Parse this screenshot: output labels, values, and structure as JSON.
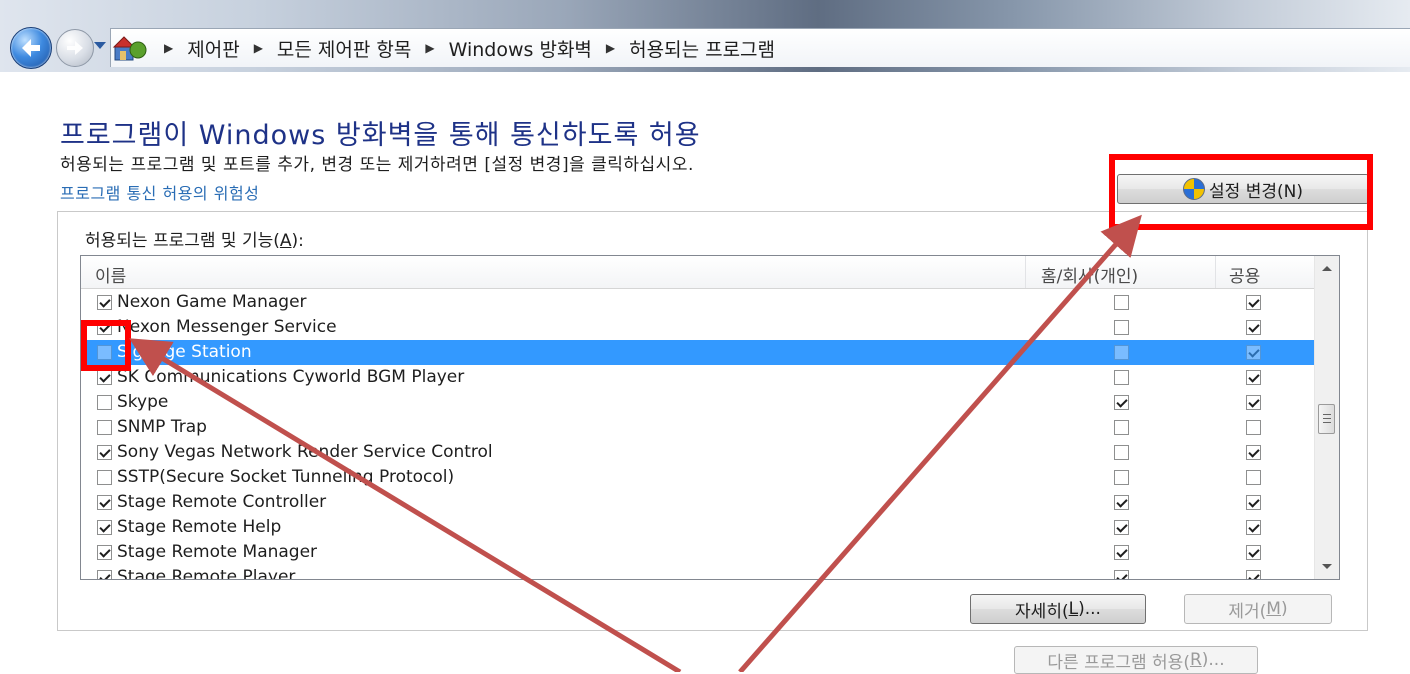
{
  "breadcrumb": {
    "items": [
      "제어판",
      "모든 제어판 항목",
      "Windows 방화벽",
      "허용되는 프로그램"
    ]
  },
  "header": {
    "title": "프로그램이 Windows 방화벽을 통해 통신하도록 허용",
    "description": "허용되는 프로그램 및 포트를 추가, 변경 또는 제거하려면 [설정 변경]을 클릭하십시오.",
    "risk_link": "프로그램 통신 허용의 위험성",
    "change_settings_label": "설정 변경(N)"
  },
  "group": {
    "label_prefix": "허용되는 프로그램 및 기능(",
    "label_accel": "A",
    "label_suffix": "):"
  },
  "list": {
    "columns": {
      "name": "이름",
      "home": "홈/회사(개인)",
      "public": "공용"
    },
    "rows": [
      {
        "name": "Nexon Game Manager",
        "enabled": true,
        "home": false,
        "public": true,
        "selected": false
      },
      {
        "name": "Nexon Messenger Service",
        "enabled": true,
        "home": false,
        "public": true,
        "selected": false
      },
      {
        "name": "Signage Station",
        "enabled": false,
        "home": false,
        "public": true,
        "selected": true
      },
      {
        "name": "SK Communications Cyworld BGM Player",
        "enabled": true,
        "home": false,
        "public": true,
        "selected": false
      },
      {
        "name": "Skype",
        "enabled": false,
        "home": true,
        "public": true,
        "selected": false
      },
      {
        "name": "SNMP Trap",
        "enabled": false,
        "home": false,
        "public": false,
        "selected": false
      },
      {
        "name": "Sony Vegas Network Render Service Control",
        "enabled": true,
        "home": false,
        "public": true,
        "selected": false
      },
      {
        "name": "SSTP(Secure Socket Tunneling Protocol)",
        "enabled": false,
        "home": false,
        "public": false,
        "selected": false
      },
      {
        "name": "Stage Remote Controller",
        "enabled": true,
        "home": true,
        "public": true,
        "selected": false
      },
      {
        "name": "Stage Remote Help",
        "enabled": true,
        "home": true,
        "public": true,
        "selected": false
      },
      {
        "name": "Stage Remote Manager",
        "enabled": true,
        "home": true,
        "public": true,
        "selected": false
      },
      {
        "name": "Stage Remote Player",
        "enabled": true,
        "home": true,
        "public": true,
        "selected": false
      }
    ]
  },
  "buttons": {
    "details_prefix": "자세히(",
    "details_accel": "L",
    "details_suffix": ")...",
    "remove_prefix": "제거(",
    "remove_accel": "M",
    "remove_suffix": ")",
    "allow_other_prefix": "다른 프로그램 허용(",
    "allow_other_accel": "R",
    "allow_other_suffix": ")..."
  },
  "colors": {
    "title": "#1e3287",
    "link": "#2a6db5",
    "selection": "#3399ff",
    "annotation": "#ff0000",
    "arrow": "#c0504d"
  },
  "icons": [
    "back-arrow-icon",
    "forward-arrow-icon",
    "control-panel-icon",
    "uac-shield-icon"
  ]
}
